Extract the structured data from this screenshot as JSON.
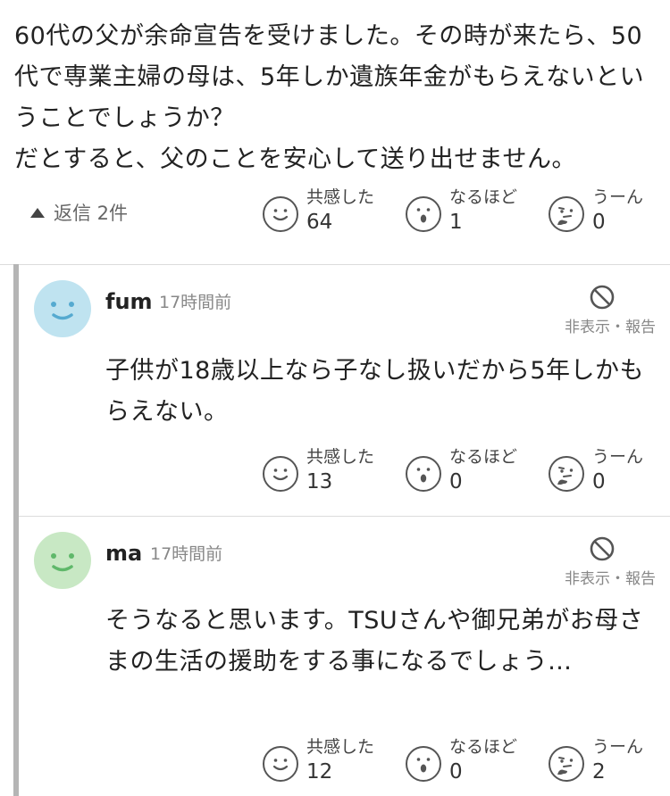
{
  "post": {
    "body": "60代の父が余命宣告を受けました。その時が来たら、50代で専業主婦の母は、5年しか遺族年金がもらえないということでしょうか？\nだとすると、父のことを安心して送り出せません。",
    "reply_toggle": "返信 2件",
    "reactions": [
      {
        "label": "共感した",
        "count": "64",
        "icon": "smile-face-icon"
      },
      {
        "label": "なるほど",
        "count": "1",
        "icon": "surprised-face-icon"
      },
      {
        "label": "うーん",
        "count": "0",
        "icon": "thinking-face-icon"
      }
    ]
  },
  "comments": [
    {
      "username": "fum",
      "time": "17時間前",
      "avatar_color": "#bfe3f0",
      "avatar_feature_color": "#55aad0",
      "hide_report": "非表示・報告",
      "body": "子供が18歳以上なら子なし扱いだから5年しかもらえない。",
      "reactions": [
        {
          "label": "共感した",
          "count": "13",
          "icon": "smile-face-icon"
        },
        {
          "label": "なるほど",
          "count": "0",
          "icon": "surprised-face-icon"
        },
        {
          "label": "うーん",
          "count": "0",
          "icon": "thinking-face-icon"
        }
      ]
    },
    {
      "username": "ma",
      "time": "17時間前",
      "avatar_color": "#c8e8c4",
      "avatar_feature_color": "#5fb86a",
      "hide_report": "非表示・報告",
      "body": "そうなると思います。TSUさんや御兄弟がお母さまの生活の援助をする事になるでしょう…",
      "reactions": [
        {
          "label": "共感した",
          "count": "12",
          "icon": "smile-face-icon"
        },
        {
          "label": "なるほど",
          "count": "0",
          "icon": "surprised-face-icon"
        },
        {
          "label": "うーん",
          "count": "2",
          "icon": "thinking-face-icon"
        }
      ]
    }
  ]
}
